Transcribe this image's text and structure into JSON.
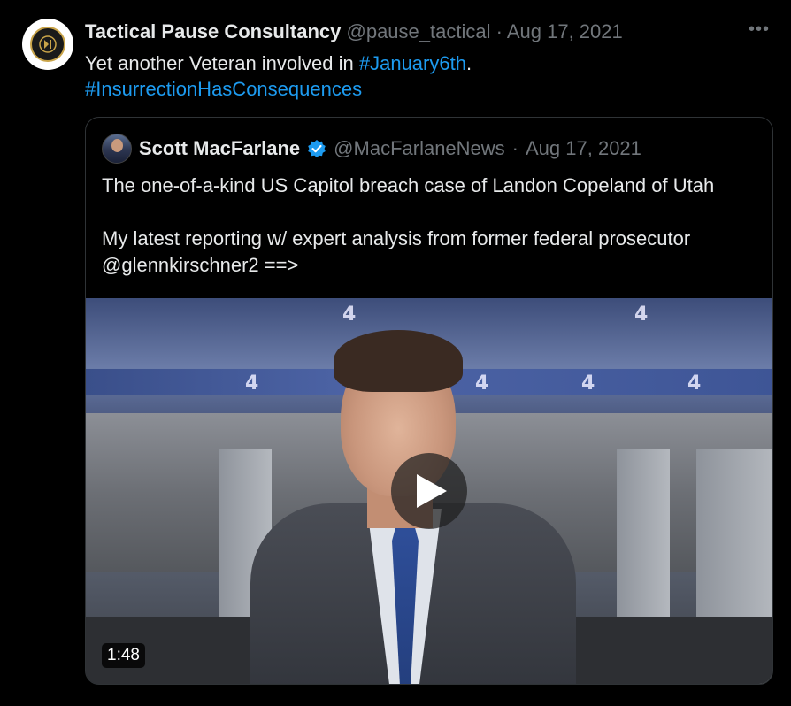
{
  "tweet": {
    "author_name": "Tactical Pause Consultancy",
    "handle": "@pause_tactical",
    "separator": "·",
    "date": "Aug 17, 2021",
    "more_icon": "more-icon",
    "text_before": "Yet another Veteran involved in ",
    "hashtag1": "#January6th",
    "text_after": ".",
    "hashtag2": "#InsurrectionHasConsequences",
    "avatar_logo": "TACTICAL PAUSE"
  },
  "quoted": {
    "author_name": "Scott MacFarlane",
    "verified_icon": "verified-badge-icon",
    "handle": "@MacFarlaneNews",
    "separator": "·",
    "date": "Aug 17, 2021",
    "paragraph1": "The one-of-a-kind US Capitol breach case of Landon Copeland of Utah",
    "paragraph2": "My latest reporting w/ expert analysis from former federal prosecutor @glennkirschner2  ==>",
    "video": {
      "duration": "1:48",
      "play_icon": "play-icon"
    }
  },
  "colors": {
    "background": "#000000",
    "text": "#e7e9ea",
    "muted": "#71767b",
    "link": "#1d9bf0",
    "border": "#2f3336"
  }
}
